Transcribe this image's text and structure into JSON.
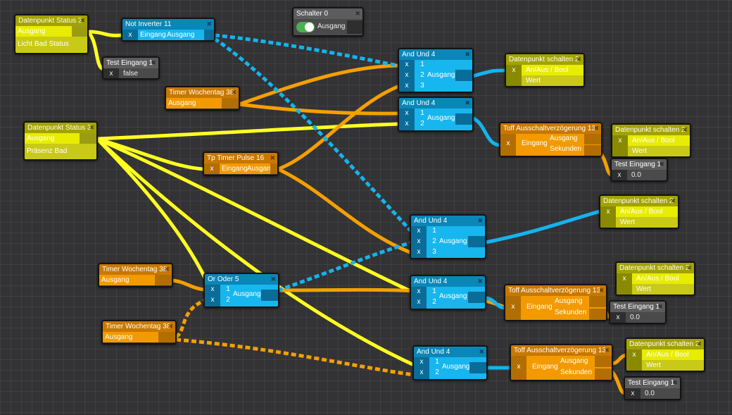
{
  "close": "✖",
  "colors": {
    "yellow": "#ffff22",
    "orange": "#f5a000",
    "blue": "#14b4ee",
    "dashed_blue": "#14b4ee"
  },
  "nodes": {
    "dp3a": {
      "title": "Datenpunkt Status 3",
      "out": "Ausgang",
      "label": "Licht Bad Status"
    },
    "not11": {
      "title": "Not Inverter 11",
      "x": "x",
      "in": "Eingang",
      "out": "Ausgang"
    },
    "test1a": {
      "title": "Test Eingang 1",
      "x": "x",
      "val": "false"
    },
    "sch0": {
      "title": "Schalter 0",
      "out": "Ausgang"
    },
    "timer38a": {
      "title": "Timer Wochentag 38",
      "out": "Ausgang"
    },
    "dp3b": {
      "title": "Datenpunkt Status 3",
      "out": "Ausgang",
      "label": "Präsenz Bad"
    },
    "tp16": {
      "title": "Tp Timer Pulse 16",
      "x": "x",
      "in": "Eingang",
      "out": "Ausgang"
    },
    "and4a": {
      "title": "And Und 4",
      "x": "x",
      "n1": "1",
      "n2": "2",
      "n3": "3",
      "out": "Ausgang"
    },
    "and4b": {
      "title": "And Und 4",
      "x": "x",
      "n1": "1",
      "n2": "2",
      "out": "Ausgang"
    },
    "dps2a": {
      "title": "Datenpunkt schalten 2",
      "x": "x",
      "in": "An/Aus / Bool",
      "label": "Wert"
    },
    "toff13a": {
      "title": "Toff Ausschaltverzögerung 13",
      "x": "x",
      "in": "Eingang",
      "o1": "Ausgang",
      "o2": "Sekunden"
    },
    "dps2b": {
      "title": "Datenpunkt schalten 2",
      "x": "x",
      "in": "An/Aus / Bool",
      "label": "Wert"
    },
    "test1b": {
      "title": "Test Eingang 1",
      "x": "x",
      "val": "0.0"
    },
    "dps2c": {
      "title": "Datenpunkt schalten 2",
      "x": "x",
      "in": "An/Aus / Bool",
      "label": "Wert"
    },
    "and4c": {
      "title": "And Und 4",
      "x": "x",
      "n1": "1",
      "n2": "2",
      "n3": "3",
      "out": "Ausgang"
    },
    "timer38b": {
      "title": "Timer Wochentag 38",
      "out": "Ausgang"
    },
    "or5": {
      "title": "Or Oder 5",
      "x": "x",
      "n1": "1",
      "n2": "2",
      "out": "Ausgang"
    },
    "and4d": {
      "title": "And Und 4",
      "x": "x",
      "n1": "1",
      "n2": "2",
      "out": "Ausgang"
    },
    "toff13b": {
      "title": "Toff Ausschaltverzögerung 13",
      "x": "x",
      "in": "Eingang",
      "o1": "Ausgang",
      "o2": "Sekunden"
    },
    "dps2d": {
      "title": "Datenpunkt schalten 2",
      "x": "x",
      "in": "An/Aus / Bool",
      "label": "Wert"
    },
    "test1c": {
      "title": "Test Eingang 1",
      "x": "x",
      "val": "0.0"
    },
    "timer38c": {
      "title": "Timer Wochentag 38",
      "out": "Ausgang"
    },
    "and4e": {
      "title": "And Und 4",
      "x": "x",
      "n1": "1",
      "n2": "2",
      "out": "Ausgang"
    },
    "toff13c": {
      "title": "Toff Ausschaltverzögerung 13",
      "x": "x",
      "in": "Eingang",
      "o1": "Ausgang",
      "o2": "Sekunden"
    },
    "dps2e": {
      "title": "Datenpunkt schalten 2",
      "x": "x",
      "in": "An/Aus / Bool",
      "label": "Wert"
    },
    "test1d": {
      "title": "Test Eingang 1",
      "x": "x",
      "val": "0.0"
    }
  }
}
